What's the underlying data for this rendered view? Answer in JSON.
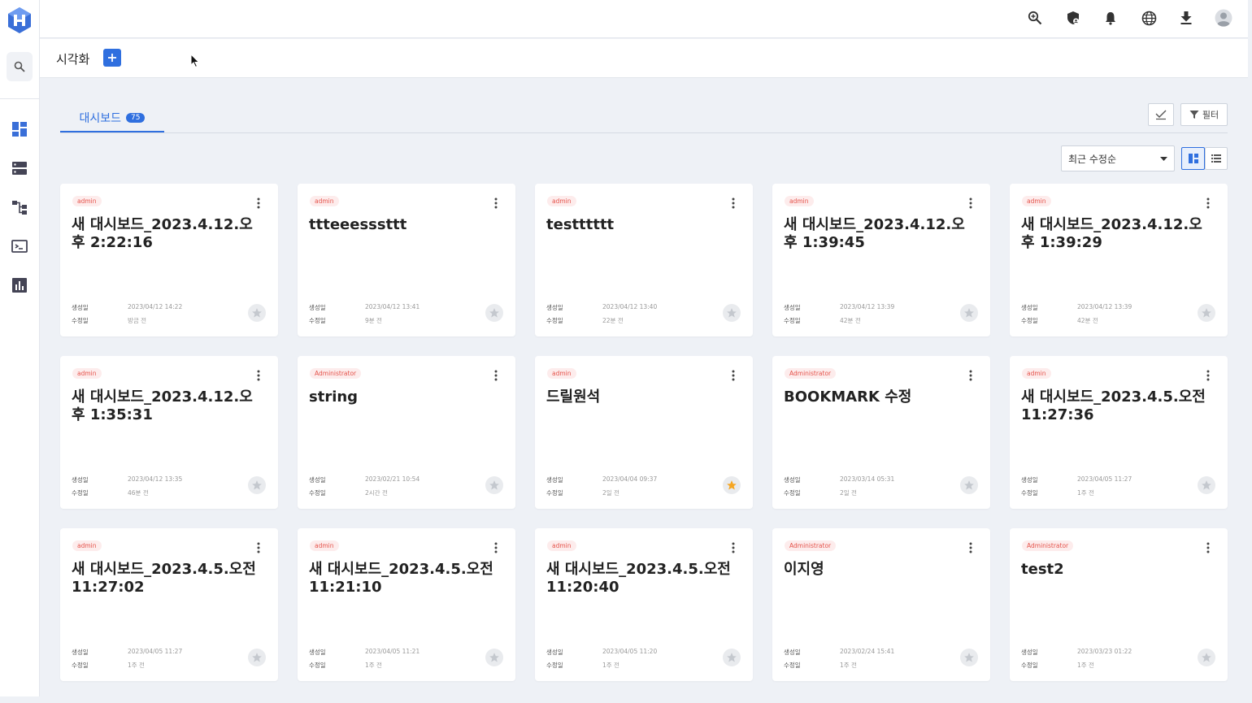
{
  "app": {
    "page_title": "시각화"
  },
  "tabs": [
    {
      "label": "대시보드",
      "count": "75"
    }
  ],
  "toolbar": {
    "filter_label": "필터",
    "sort_selected": "최근 수정순"
  },
  "meta_labels": {
    "created": "생성일",
    "modified": "수정일"
  },
  "colors": {
    "accent": "#2f6fdf",
    "star_active": "#f5a623",
    "badge_text": "#e5534b"
  },
  "cards": [
    {
      "owner": "admin",
      "title": "새 대시보드_2023.4.12.오후 2:22:16",
      "created": "2023/04/12 14:22",
      "modified": "방금 전",
      "starred": false
    },
    {
      "owner": "admin",
      "title": "ttteeesssttt",
      "created": "2023/04/12 13:41",
      "modified": "9분 전",
      "starred": false
    },
    {
      "owner": "admin",
      "title": "testttttt",
      "created": "2023/04/12 13:40",
      "modified": "22분 전",
      "starred": false
    },
    {
      "owner": "admin",
      "title": "새 대시보드_2023.4.12.오후 1:39:45",
      "created": "2023/04/12 13:39",
      "modified": "42분 전",
      "starred": false
    },
    {
      "owner": "admin",
      "title": "새 대시보드_2023.4.12.오후 1:39:29",
      "created": "2023/04/12 13:39",
      "modified": "42분 전",
      "starred": false
    },
    {
      "owner": "admin",
      "title": "새 대시보드_2023.4.12.오후 1:35:31",
      "created": "2023/04/12 13:35",
      "modified": "46분 전",
      "starred": false
    },
    {
      "owner": "Administrator",
      "title": "string",
      "created": "2023/02/21 10:54",
      "modified": "2시간 전",
      "starred": false
    },
    {
      "owner": "admin",
      "title": "드릴원석",
      "created": "2023/04/04 09:37",
      "modified": "2일 전",
      "starred": true
    },
    {
      "owner": "Administrator",
      "title": "BOOKMARK 수정",
      "created": "2023/03/14 05:31",
      "modified": "2일 전",
      "starred": false
    },
    {
      "owner": "admin",
      "title": "새 대시보드_2023.4.5.오전 11:27:36",
      "created": "2023/04/05 11:27",
      "modified": "1주 전",
      "starred": false
    },
    {
      "owner": "admin",
      "title": "새 대시보드_2023.4.5.오전 11:27:02",
      "created": "2023/04/05 11:27",
      "modified": "1주 전",
      "starred": false
    },
    {
      "owner": "admin",
      "title": "새 대시보드_2023.4.5.오전 11:21:10",
      "created": "2023/04/05 11:21",
      "modified": "1주 전",
      "starred": false
    },
    {
      "owner": "admin",
      "title": "새 대시보드_2023.4.5.오전 11:20:40",
      "created": "2023/04/05 11:20",
      "modified": "1주 전",
      "starred": false
    },
    {
      "owner": "Administrator",
      "title": "이지영",
      "created": "2023/02/24 15:41",
      "modified": "1주 전",
      "starred": false
    },
    {
      "owner": "Administrator",
      "title": "test2",
      "created": "2023/03/23 01:22",
      "modified": "1주 전",
      "starred": false
    }
  ],
  "icons": {
    "sidebar": [
      "logo-icon",
      "search-icon",
      "dashboard-icon",
      "storage-icon",
      "flow-icon",
      "terminal-icon",
      "chart-icon"
    ],
    "topbar": [
      "zoom-icon",
      "shield-user-icon",
      "bell-icon",
      "globe-icon",
      "download-icon",
      "user-avatar-icon"
    ]
  }
}
